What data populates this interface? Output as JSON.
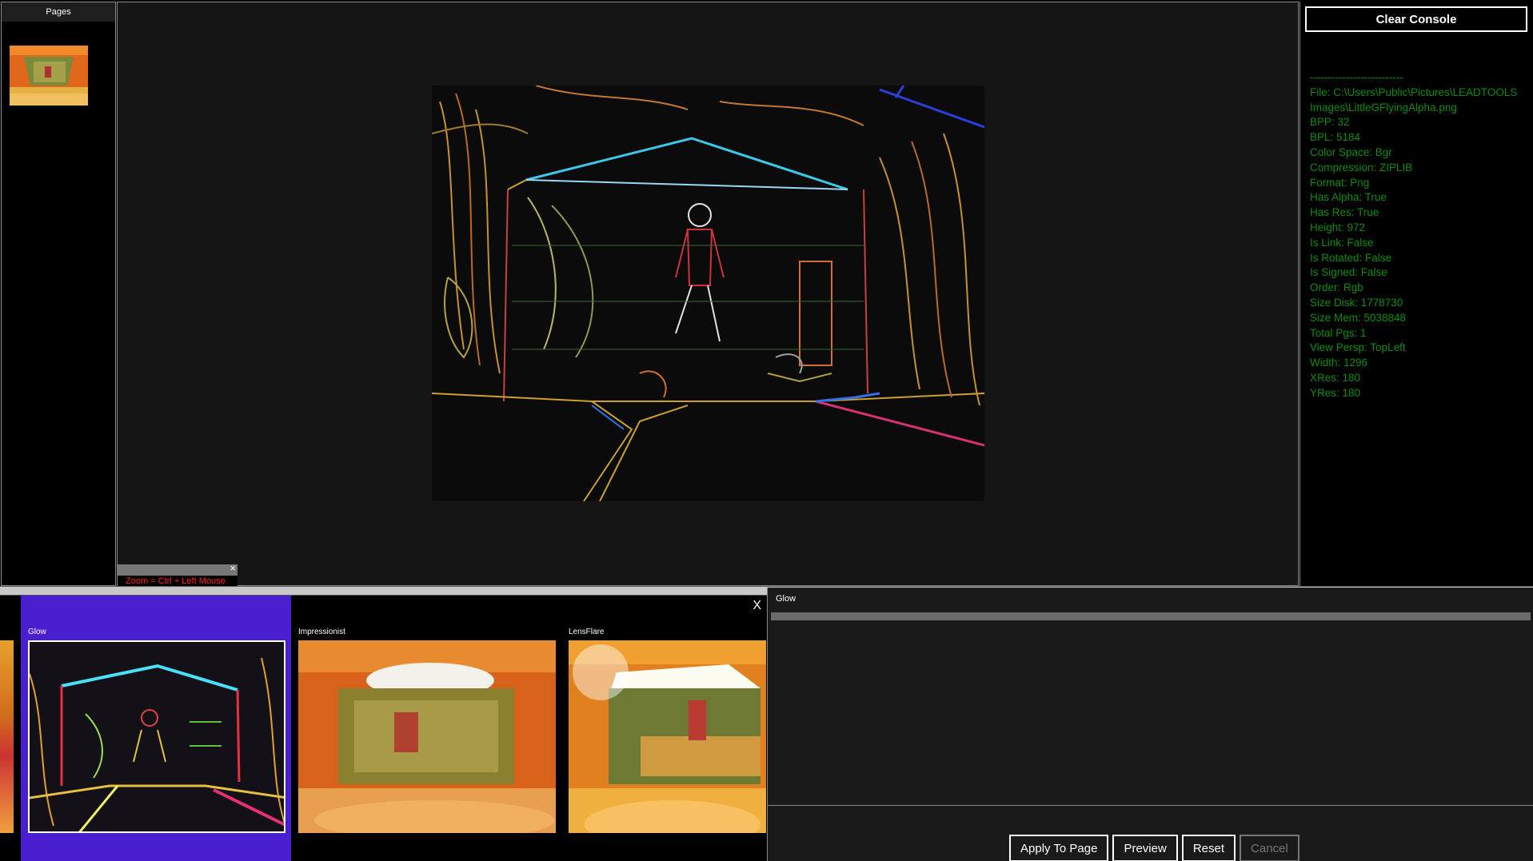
{
  "pages_panel": {
    "header": "Pages"
  },
  "viewer": {
    "zoom_hint": "Zoom = Ctrl + Left Mouse",
    "zoom_hint_close": "×"
  },
  "console": {
    "clear_button": "Clear Console",
    "lines": [
      "--------------------------",
      "File: C:\\Users\\Public\\Pictures\\LEADTOOLS",
      "Images\\LittleGFlyingAlpha.png",
      "BPP: 32",
      "BPL: 5184",
      "Color Space: Bgr",
      "Compression: ZIPLIB",
      "Format: Png",
      "Has Alpha: True",
      "Has Res: True",
      "Height: 972",
      "Is Link: False",
      "Is Rotated: False",
      "Is Signed: False",
      "Order: Rgb",
      "Size Disk: 1778730",
      "Size Mem: 5038848",
      "Total Pgs: 1",
      "View Persp: TopLeft",
      "Width: 1296",
      "XRes: 180",
      "YRes: 180"
    ],
    "text_color": "#0f8b0f"
  },
  "gallery": {
    "close": "X",
    "effects": [
      {
        "label": "Glow",
        "selected": true
      },
      {
        "label": "Impressionist",
        "selected": false
      },
      {
        "label": "LensFlare",
        "selected": false
      }
    ],
    "selected_color": "#4a1fcf"
  },
  "properties": {
    "title": "Glow",
    "buttons": {
      "apply": "Apply To Page",
      "preview": "Preview",
      "reset": "Reset",
      "cancel": "Cancel"
    }
  }
}
